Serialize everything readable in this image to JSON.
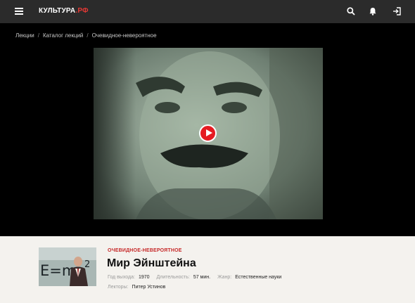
{
  "header": {
    "logo_text": "КУЛЬТУРА",
    "logo_dot": ".",
    "logo_suffix": "РФ",
    "icons": [
      "menu-icon",
      "search-icon",
      "bell-icon",
      "login-icon"
    ]
  },
  "breadcrumbs": [
    {
      "label": "Лекции"
    },
    {
      "label": "Каталог лекций"
    },
    {
      "label": "Очевидное-невероятное"
    }
  ],
  "breadcrumb_separator": "/",
  "video": {
    "play_icon": "play-icon"
  },
  "lecture": {
    "category": "ОЧЕВИДНОЕ-НЕВЕРОЯТНОЕ",
    "title": "Мир Эйнштейна",
    "year_label": "Год выхода:",
    "year": "1970",
    "duration_label": "Длительность:",
    "duration": "57 мин.",
    "genre_label": "Жанр:",
    "genre": "Естественные науки",
    "lecturers_label": "Лекторы:",
    "lecturers": "Питер Устинов",
    "thumb_text": "E=m",
    "thumb_sup": "2"
  },
  "colors": {
    "topbar": "#2b2b2b",
    "accent": "#e51b22",
    "info_bg": "#f4f2ee"
  }
}
